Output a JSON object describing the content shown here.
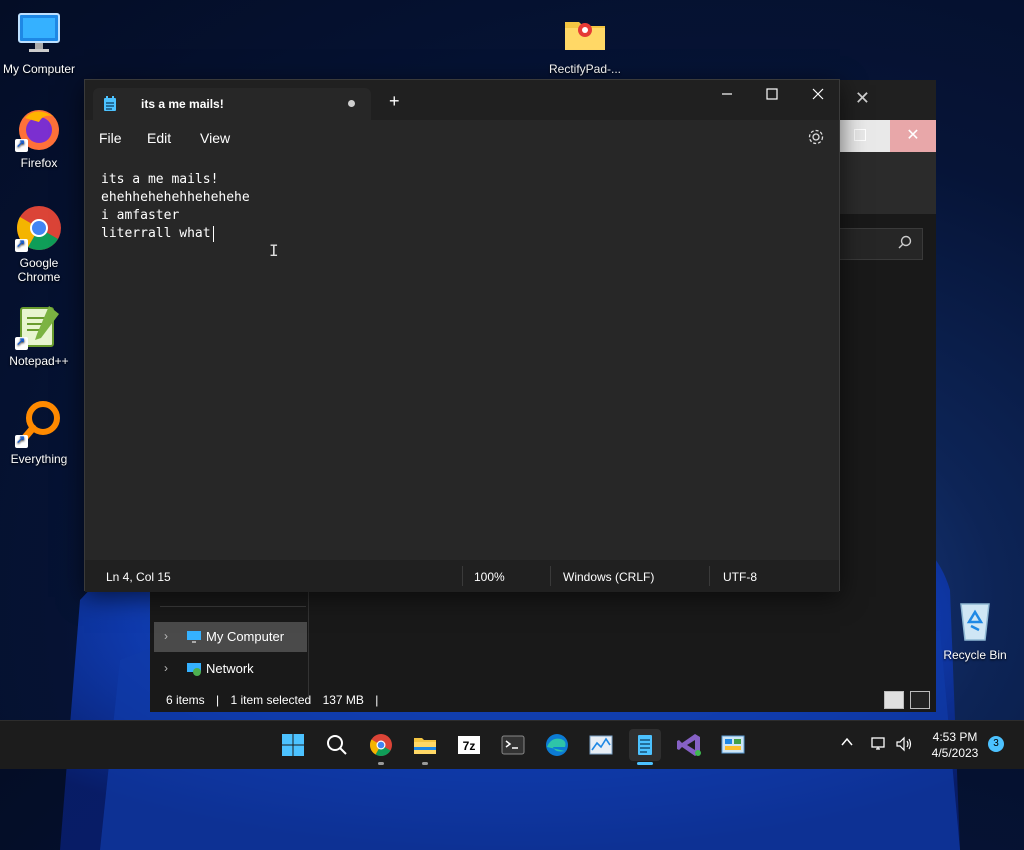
{
  "desktop": {
    "icons": [
      {
        "label": "My Computer",
        "icon": "monitor-icon"
      },
      {
        "label": "RectifyPad-...",
        "icon": "folder-icon"
      },
      {
        "label": "Firefox",
        "icon": "firefox-icon"
      },
      {
        "label": "Google Chrome",
        "icon": "chrome-icon"
      },
      {
        "label": "Notepad++",
        "icon": "notepadpp-icon"
      },
      {
        "label": "Everything",
        "icon": "magnifier-icon"
      },
      {
        "label": "Recycle Bin",
        "icon": "recycle-bin-icon"
      }
    ]
  },
  "explorer": {
    "nav": [
      {
        "label": "My Computer",
        "selected": true
      },
      {
        "label": "Network",
        "selected": false
      }
    ],
    "status": {
      "items": "6 items",
      "selection": "1 item selected",
      "size": "137 MB",
      "sep": "|"
    }
  },
  "notepad": {
    "tab_title": "its a me mails!",
    "new_tab": "+",
    "menu": {
      "file": "File",
      "edit": "Edit",
      "view": "View"
    },
    "lines": [
      "its a me mails!",
      "ehehhehehehhehehehe",
      "i amfaster",
      "literrall what"
    ],
    "status": {
      "position": "Ln 4, Col 15",
      "zoom": "100%",
      "line_ending": "Windows (CRLF)",
      "encoding": "UTF-8"
    }
  },
  "taskbar": {
    "apps": [
      "start-icon",
      "search-icon",
      "chrome-icon",
      "file-explorer-icon",
      "7zip-icon",
      "terminal-icon",
      "edge-icon",
      "task-manager-icon",
      "notepad-icon",
      "visual-studio-icon",
      "control-panel-icon"
    ],
    "clock": {
      "time": "4:53 PM",
      "date": "4/5/2023"
    },
    "notifications": "3"
  },
  "colors": {
    "accent": "#4cc2ff",
    "notepad_bg": "#272727",
    "titlebar": "#202020"
  }
}
